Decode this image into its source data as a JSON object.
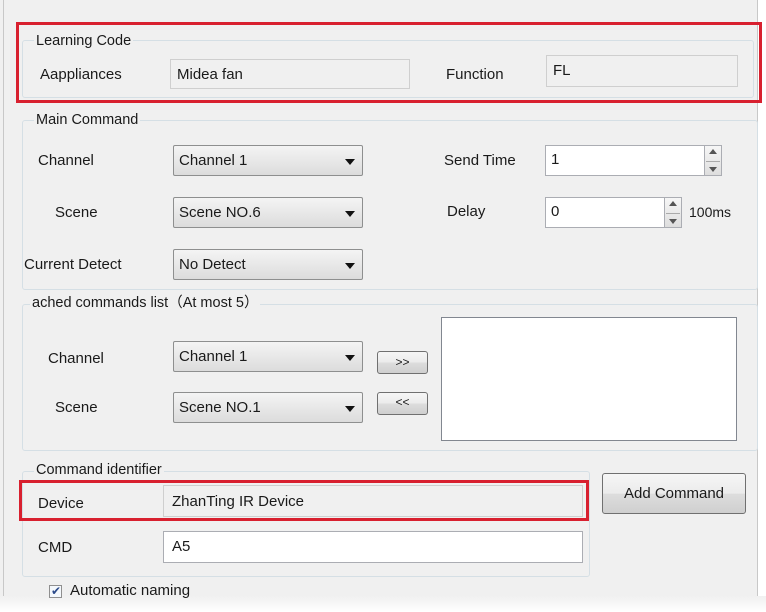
{
  "learning_code": {
    "legend": "Learning Code",
    "appliances_label": "Aappliances",
    "appliances_value": "Midea fan",
    "function_label": "Function",
    "function_value": "FL"
  },
  "main_command": {
    "legend": "Main Command",
    "channel_label": "Channel",
    "channel_value": "Channel 1",
    "scene_label": "Scene",
    "scene_value": "Scene NO.6",
    "current_detect_label": "Current Detect",
    "current_detect_value": "No Detect",
    "send_time_label": "Send Time",
    "send_time_value": "1",
    "delay_label": "Delay",
    "delay_value": "0",
    "delay_unit": "100ms"
  },
  "attached_commands": {
    "legend": "ached commands list（At most 5）",
    "channel_label": "Channel",
    "channel_value": "Channel 1",
    "scene_label": "Scene",
    "scene_value": "Scene NO.1",
    "add_button": ">>",
    "remove_button": "<<",
    "list_items": []
  },
  "command_identifier": {
    "legend": "Command identifier",
    "device_label": "Device",
    "device_value": "ZhanTing IR Device",
    "cmd_label": "CMD",
    "cmd_value": "A5"
  },
  "add_command_button": "Add Command",
  "automatic_naming": {
    "label": "Automatic naming",
    "checked": true
  },
  "colors": {
    "highlight": "#d8202f",
    "background": "#f0f0f0"
  }
}
